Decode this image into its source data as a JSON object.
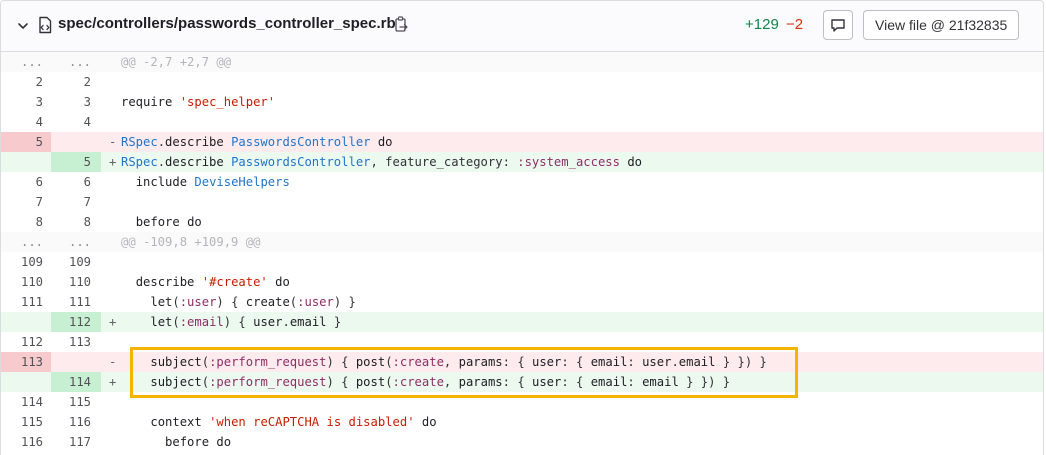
{
  "file": {
    "path": "spec/controllers/passwords_controller_spec.rb",
    "additions": "+129",
    "deletions": "−2",
    "view_file_label": "View file @ 21f32835",
    "icons": [
      "chevron-down-icon",
      "file-icon",
      "copy-icon",
      "comment-icon"
    ]
  },
  "lines": [
    {
      "type": "hunk",
      "old": "...",
      "new": "...",
      "sign": "",
      "text": "@@ -2,7 +2,7 @@"
    },
    {
      "type": "ctx",
      "old": "2",
      "new": "2",
      "sign": "",
      "text": ""
    },
    {
      "type": "ctx",
      "old": "3",
      "new": "3",
      "sign": "",
      "text": "require 'spec_helper'"
    },
    {
      "type": "ctx",
      "old": "4",
      "new": "4",
      "sign": "",
      "text": ""
    },
    {
      "type": "del",
      "old": "5",
      "new": "",
      "sign": "-",
      "text": "RSpec.describe PasswordsController do"
    },
    {
      "type": "add",
      "old": "",
      "new": "5",
      "sign": "+",
      "text": "RSpec.describe PasswordsController, feature_category: :system_access do"
    },
    {
      "type": "ctx",
      "old": "6",
      "new": "6",
      "sign": "",
      "text": "  include DeviseHelpers"
    },
    {
      "type": "ctx",
      "old": "7",
      "new": "7",
      "sign": "",
      "text": ""
    },
    {
      "type": "ctx",
      "old": "8",
      "new": "8",
      "sign": "",
      "text": "  before do"
    },
    {
      "type": "hunk",
      "old": "...",
      "new": "...",
      "sign": "",
      "text": "@@ -109,8 +109,9 @@"
    },
    {
      "type": "ctx",
      "old": "109",
      "new": "109",
      "sign": "",
      "text": ""
    },
    {
      "type": "ctx",
      "old": "110",
      "new": "110",
      "sign": "",
      "text": "  describe '#create' do"
    },
    {
      "type": "ctx",
      "old": "111",
      "new": "111",
      "sign": "",
      "text": "    let(:user) { create(:user) }"
    },
    {
      "type": "add",
      "old": "",
      "new": "112",
      "sign": "+",
      "text": "    let(:email) { user.email }"
    },
    {
      "type": "ctx",
      "old": "112",
      "new": "113",
      "sign": "",
      "text": ""
    },
    {
      "type": "del",
      "old": "113",
      "new": "",
      "sign": "-",
      "text": "    subject(:perform_request) { post(:create, params: { user: { email: user.email } }) }"
    },
    {
      "type": "add",
      "old": "",
      "new": "114",
      "sign": "+",
      "text": "    subject(:perform_request) { post(:create, params: { user: { email: email } }) }"
    },
    {
      "type": "ctx",
      "old": "114",
      "new": "115",
      "sign": "",
      "text": ""
    },
    {
      "type": "ctx",
      "old": "115",
      "new": "116",
      "sign": "",
      "text": "    context 'when reCAPTCHA is disabled' do"
    },
    {
      "type": "ctx",
      "old": "116",
      "new": "117",
      "sign": "",
      "text": "      before do"
    }
  ]
}
